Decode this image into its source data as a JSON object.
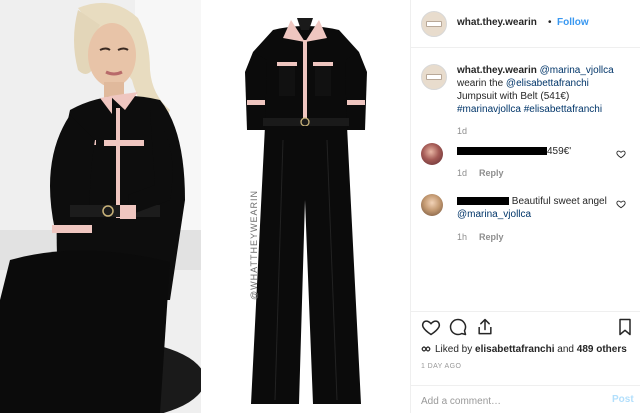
{
  "post": {
    "account_handle": "what.they.wearin",
    "separator": "•",
    "follow_label": "Follow"
  },
  "caption": {
    "user": "what.they.wearin",
    "mention": "@marina_vjollca",
    "line2_prefix": "wearin the ",
    "brand_mention": "@elisabettafranchi",
    "line3": "Jumpsuit with Belt (541€)",
    "tag1": "#marinavjollca",
    "tag2": "#elisabettafranchi",
    "time": "1d"
  },
  "comments": [
    {
      "text": "459€'",
      "time": "1d",
      "reply_label": "Reply"
    },
    {
      "text": "Beautiful sweet angel",
      "mention": "@marina_vjollca",
      "time": "1h",
      "reply_label": "Reply"
    }
  ],
  "likes": {
    "prefix": "Liked by ",
    "user": "elisabettafranchi",
    "middle": " and ",
    "count": "489 others"
  },
  "posted_ago": "1 DAY AGO",
  "comment_box": {
    "placeholder": "Add a comment…",
    "post_label": "Post"
  },
  "image": {
    "watermark": "@WHATTHEYWEARIN"
  },
  "colors": {
    "link_blue": "#3897f0",
    "dark_blue": "#003569",
    "jumpsuit": "#0b0b0b",
    "trim_pink": "#efc6c0"
  },
  "icons": [
    "heart-icon",
    "comment-icon",
    "share-icon",
    "bookmark-icon",
    "avatar"
  ]
}
